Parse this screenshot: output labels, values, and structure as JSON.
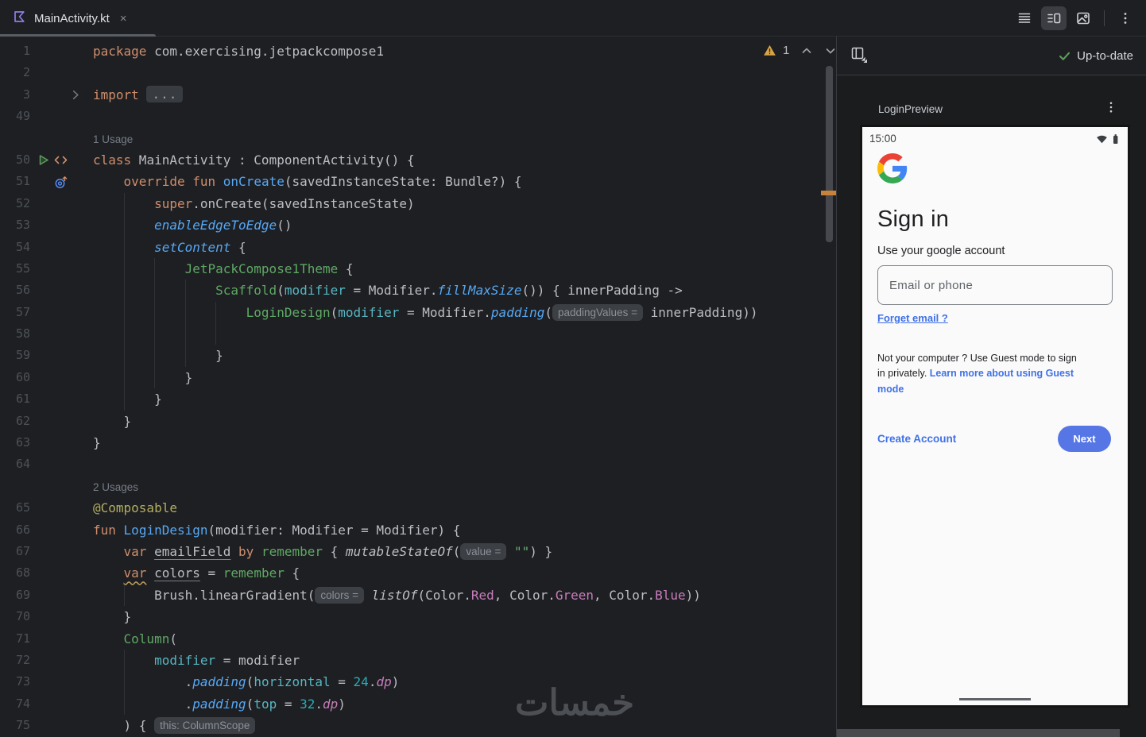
{
  "window": {
    "tab": {
      "title": "MainActivity.kt",
      "close_label": "×",
      "icon": "kotlin-file-icon"
    },
    "editor_modes": {
      "icons": [
        "code-view-icon",
        "split-view-icon",
        "design-view-icon",
        "kebab-menu-icon"
      ],
      "active": "split-view-icon"
    }
  },
  "editor": {
    "inspections": {
      "warning_count": "1",
      "icons": [
        "warning-icon",
        "chevron-up-icon",
        "chevron-down-icon"
      ]
    },
    "lines": [
      {
        "num": "1",
        "ind": 0,
        "g": [],
        "segs": [
          [
            "kw",
            "package"
          ],
          [
            "pl",
            " com.exercising.jetpackcompose1"
          ]
        ]
      },
      {
        "num": "2",
        "ind": 0,
        "g": [],
        "segs": []
      },
      {
        "num": "3",
        "ind": 0,
        "g": [],
        "fold": true,
        "segs": [
          [
            "kw",
            "import"
          ],
          [
            "pl",
            " "
          ],
          [
            "foldchip",
            "..."
          ]
        ]
      },
      {
        "num": "49",
        "ind": 0,
        "g": [],
        "segs": []
      },
      {
        "num": "",
        "ind": 0,
        "g": [],
        "label": "1 Usage",
        "segs": []
      },
      {
        "num": "50",
        "ind": 0,
        "g": [],
        "gutter": [
          "run-icon",
          "markup-icon"
        ],
        "segs": [
          [
            "kw",
            "class"
          ],
          [
            "pl",
            " MainActivity : ComponentActivity() {"
          ]
        ]
      },
      {
        "num": "51",
        "ind": 4,
        "g": [],
        "gutter": [
          "override-icon"
        ],
        "segs": [
          [
            "kw",
            "override"
          ],
          [
            "pl",
            " "
          ],
          [
            "kw",
            "fun"
          ],
          [
            "pl",
            " "
          ],
          [
            "fn",
            "onCreate"
          ],
          [
            "pl",
            "(savedInstanceState: Bundle?) {"
          ]
        ]
      },
      {
        "num": "52",
        "ind": 8,
        "g": [
          4
        ],
        "segs": [
          [
            "kw",
            "super"
          ],
          [
            "pl",
            ".onCreate(savedInstanceState)"
          ]
        ]
      },
      {
        "num": "53",
        "ind": 8,
        "g": [
          4
        ],
        "segs": [
          [
            "fni",
            "enableEdgeToEdge"
          ],
          [
            "pl",
            "()"
          ]
        ]
      },
      {
        "num": "54",
        "ind": 8,
        "g": [
          4
        ],
        "segs": [
          [
            "fni",
            "setContent"
          ],
          [
            "pl",
            " {"
          ]
        ]
      },
      {
        "num": "55",
        "ind": 12,
        "g": [
          4,
          8
        ],
        "segs": [
          [
            "cm",
            "JetPackCompose1Theme"
          ],
          [
            "pl",
            " {"
          ]
        ]
      },
      {
        "num": "56",
        "ind": 16,
        "g": [
          4,
          8,
          12
        ],
        "segs": [
          [
            "cm",
            "Scaffold"
          ],
          [
            "pl",
            "("
          ],
          [
            "na",
            "modifier"
          ],
          [
            "pl",
            " = Modifier."
          ],
          [
            "fni",
            "fillMaxSize"
          ],
          [
            "pl",
            "()) { innerPadding ->"
          ]
        ]
      },
      {
        "num": "57",
        "ind": 20,
        "g": [
          4,
          8,
          12,
          16
        ],
        "segs": [
          [
            "cm",
            "LoginDesign"
          ],
          [
            "pl",
            "("
          ],
          [
            "na",
            "modifier"
          ],
          [
            "pl",
            " = Modifier."
          ],
          [
            "fni",
            "padding"
          ],
          [
            "pl",
            "("
          ],
          [
            "hint",
            "paddingValues ="
          ],
          [
            "pl",
            " innerPadding))"
          ]
        ]
      },
      {
        "num": "58",
        "ind": 0,
        "g": [
          4,
          8,
          12,
          16
        ],
        "segs": []
      },
      {
        "num": "59",
        "ind": 16,
        "g": [
          4,
          8,
          12
        ],
        "segs": [
          [
            "pl",
            "}"
          ]
        ]
      },
      {
        "num": "60",
        "ind": 12,
        "g": [
          4,
          8
        ],
        "segs": [
          [
            "pl",
            "}"
          ]
        ]
      },
      {
        "num": "61",
        "ind": 8,
        "g": [
          4
        ],
        "segs": [
          [
            "pl",
            "}"
          ]
        ]
      },
      {
        "num": "62",
        "ind": 4,
        "g": [],
        "segs": [
          [
            "pl",
            "}"
          ]
        ]
      },
      {
        "num": "63",
        "ind": 0,
        "g": [],
        "segs": [
          [
            "pl",
            "}"
          ]
        ]
      },
      {
        "num": "64",
        "ind": 0,
        "g": [],
        "segs": []
      },
      {
        "num": "",
        "ind": 0,
        "g": [],
        "label": "2 Usages",
        "segs": []
      },
      {
        "num": "65",
        "ind": 0,
        "g": [],
        "segs": [
          [
            "ann",
            "@Composable"
          ]
        ]
      },
      {
        "num": "66",
        "ind": 0,
        "g": [],
        "segs": [
          [
            "kw",
            "fun"
          ],
          [
            "pl",
            " "
          ],
          [
            "fn",
            "LoginDesign"
          ],
          [
            "pl",
            "(modifier: Modifier = Modifier) {"
          ]
        ]
      },
      {
        "num": "67",
        "ind": 4,
        "g": [],
        "segs": [
          [
            "kw",
            "var"
          ],
          [
            "pl",
            " "
          ],
          [
            "ul",
            "emailField"
          ],
          [
            "pl",
            " "
          ],
          [
            "kw",
            "by"
          ],
          [
            "pl",
            " "
          ],
          [
            "cm",
            "remember"
          ],
          [
            "pl",
            " { "
          ],
          [
            "it",
            "mutableStateOf"
          ],
          [
            "pl",
            "("
          ],
          [
            "hint",
            "value ="
          ],
          [
            "pl",
            " "
          ],
          [
            "str",
            "\"\""
          ],
          [
            "pl",
            ") }"
          ]
        ]
      },
      {
        "num": "68",
        "ind": 4,
        "g": [],
        "segs": [
          [
            "kww",
            "var"
          ],
          [
            "pl",
            " "
          ],
          [
            "ul",
            "colors"
          ],
          [
            "pl",
            " = "
          ],
          [
            "cm",
            "remember"
          ],
          [
            "pl",
            " {"
          ]
        ]
      },
      {
        "num": "69",
        "ind": 8,
        "g": [
          4
        ],
        "segs": [
          [
            "pl",
            "Brush.linearGradient("
          ],
          [
            "hint",
            "colors ="
          ],
          [
            "pl",
            " "
          ],
          [
            "it",
            "listOf"
          ],
          [
            "pl",
            "(Color."
          ],
          [
            "prop",
            "Red"
          ],
          [
            "pl",
            ", Color."
          ],
          [
            "prop",
            "Green"
          ],
          [
            "pl",
            ", Color."
          ],
          [
            "prop",
            "Blue"
          ],
          [
            "pl",
            "))"
          ]
        ]
      },
      {
        "num": "70",
        "ind": 4,
        "g": [],
        "segs": [
          [
            "pl",
            "}"
          ]
        ]
      },
      {
        "num": "71",
        "ind": 4,
        "g": [],
        "segs": [
          [
            "cm",
            "Column"
          ],
          [
            "pl",
            "("
          ]
        ]
      },
      {
        "num": "72",
        "ind": 8,
        "g": [
          4
        ],
        "segs": [
          [
            "na",
            "modifier"
          ],
          [
            "pl",
            " = modifier"
          ]
        ]
      },
      {
        "num": "73",
        "ind": 12,
        "g": [
          4
        ],
        "segs": [
          [
            "pl",
            "."
          ],
          [
            "fni",
            "padding"
          ],
          [
            "pl",
            "("
          ],
          [
            "na",
            "horizontal"
          ],
          [
            "pl",
            " = "
          ],
          [
            "nm",
            "24"
          ],
          [
            "pl",
            "."
          ],
          [
            "ext",
            "dp"
          ],
          [
            "pl",
            ")"
          ]
        ]
      },
      {
        "num": "74",
        "ind": 12,
        "g": [
          4
        ],
        "segs": [
          [
            "pl",
            "."
          ],
          [
            "fni",
            "padding"
          ],
          [
            "pl",
            "("
          ],
          [
            "na",
            "top"
          ],
          [
            "pl",
            " = "
          ],
          [
            "nm",
            "32"
          ],
          [
            "pl",
            "."
          ],
          [
            "ext",
            "dp"
          ],
          [
            "pl",
            ")"
          ]
        ]
      },
      {
        "num": "75",
        "ind": 4,
        "g": [],
        "segs": [
          [
            "pl",
            ") { "
          ],
          [
            "hint",
            "this: ColumnScope"
          ]
        ]
      }
    ]
  },
  "preview_panel": {
    "toolbar": {
      "status": "Up-to-date",
      "icons": [
        "layout-view-icon",
        "check-icon"
      ]
    },
    "preview_title": "LoginPreview",
    "menu_icon": "kebab-menu-icon",
    "phone": {
      "status_time": "15:00",
      "status_icons": [
        "wifi-icon",
        "battery-icon"
      ],
      "logo_icon": "google-logo",
      "title": "Sign in",
      "subtitle": "Use your google account",
      "email_placeholder": "Email or phone",
      "forget_link": "Forget email ?",
      "guest_text_part1": "Not your computer ? Use Guest mode to sign in privately. ",
      "guest_link": "Learn more about using Guest mode",
      "create_account": "Create Account",
      "next_button": "Next"
    }
  },
  "watermark": "خمسات",
  "colors": {
    "bg": "#1E1F22",
    "panel_bg": "#1B1C1E",
    "border": "#393B40",
    "keyword": "#CF8E6D",
    "plain": "#BCBEC4",
    "function_blue": "#56A8F5",
    "composable_green": "#5FA865",
    "named_arg_teal": "#56B6C2",
    "string_green": "#6AAB73",
    "number_cyan": "#2AACB8",
    "property_purple": "#C77DBB",
    "annotation_yellow": "#B3AE60",
    "line_number": "#4D5258",
    "warning_stripe": "#C8823B",
    "google_blue_link": "#4071E8",
    "next_button_blue": "#5776E5",
    "uptodate_green": "#5C9E5C"
  }
}
